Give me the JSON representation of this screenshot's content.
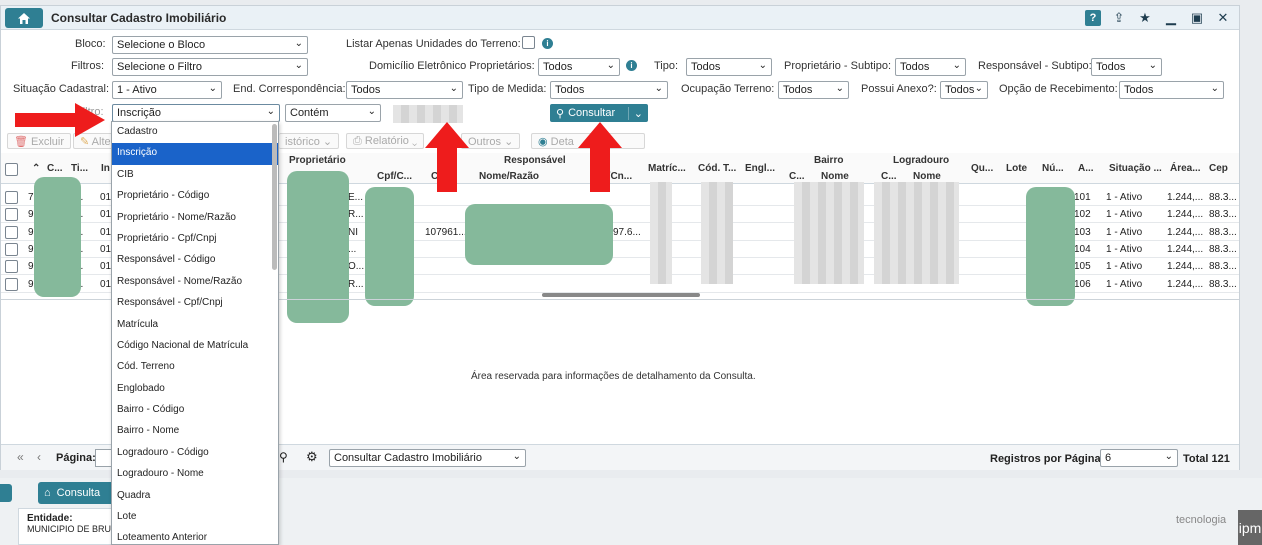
{
  "window": {
    "title": "Consultar Cadastro Imobiliário"
  },
  "filters": {
    "bloco_label": "Bloco:",
    "bloco_value": "Selecione o Bloco",
    "filtros_label": "Filtros:",
    "filtros_value": "Selecione o Filtro",
    "situacao_label": "Situação Cadastral:",
    "situacao_value": "1 - Ativo",
    "listar_label": "Listar Apenas Unidades do Terreno:",
    "domicilio_label": "Domicílio Eletrônico Proprietários:",
    "domicilio_value": "Todos",
    "tipo_label": "Tipo:",
    "tipo_value": "Todos",
    "prop_subtipo_label": "Proprietário - Subtipo:",
    "prop_subtipo_value": "Todos",
    "resp_subtipo_label": "Responsável - Subtipo:",
    "resp_subtipo_value": "Todos",
    "end_label": "End. Correspondência:",
    "end_value": "Todos",
    "medida_label": "Tipo de Medida:",
    "medida_value": "Todos",
    "ocupacao_label": "Ocupação Terreno:",
    "ocupacao_value": "Todos",
    "anexo_label": "Possui Anexo?:",
    "anexo_value": "Todos",
    "recebimento_label": "Opção de Recebimento:",
    "recebimento_value": "Todos",
    "filtro_label": "Filtro:",
    "filtro_value": "Inscrição",
    "operador_value": "Contém",
    "consultar_label": "Consultar"
  },
  "toolbar": {
    "excluir": "Excluir",
    "alterar": "Alte",
    "historico": "istórico",
    "relatorio": "Relatório",
    "outros": "Outros",
    "detalhes": "Deta"
  },
  "grid": {
    "h_c": "C...",
    "h_ti": "Ti...",
    "h_in": "In",
    "h_proprietario": "Proprietário",
    "h_cpf": "Cpf/C...",
    "h_responsavel": "Responsável",
    "h_c2": "C",
    "h_nome_razao": "Nome/Razão",
    "h_cpfcn": "Cpf/Cn...",
    "h_matric": "Matríc...",
    "h_cod_t": "Cód. T...",
    "h_engl": "Engl...",
    "h_bairro": "Bairro",
    "h_bc": "C...",
    "h_bnome": "Nome",
    "h_logradouro": "Logradouro",
    "h_lc": "C...",
    "h_lnome": "Nome",
    "h_qu": "Qu...",
    "h_lote": "Lote",
    "h_nu": "Nú...",
    "h_a": "A...",
    "h_situacao": "Situação ...",
    "h_area": "Área...",
    "h_cep": "Cep",
    "rows": [
      {
        "c": "7",
        "ti": "...",
        "in": "01.",
        "prop": "E...",
        "resp_c": "",
        "resp_cpf": "",
        "a": "101",
        "sit": "1 - Ativo",
        "area": "1.244,...",
        "cep": "88.3..."
      },
      {
        "c": "9",
        "ti": "...",
        "in": "01.",
        "prop": "R...",
        "resp_c": "",
        "resp_cpf": "",
        "a": "102",
        "sit": "1 - Ativo",
        "area": "1.244,...",
        "cep": "88.3..."
      },
      {
        "c": "9",
        "ti": "...",
        "in": "01.",
        "prop": "NI",
        "resp_c": "107961...",
        "resp_cpf": "97.6...",
        "a": "103",
        "sit": "1 - Ativo",
        "area": "1.244,...",
        "cep": "88.3..."
      },
      {
        "c": "9",
        "ti": "...",
        "in": "01.",
        "prop": "...",
        "resp_c": "",
        "resp_cpf": "",
        "a": "104",
        "sit": "1 - Ativo",
        "area": "1.244,...",
        "cep": "88.3..."
      },
      {
        "c": "9",
        "ti": "...",
        "in": "01.",
        "prop": "O...",
        "resp_c": "",
        "resp_cpf": "",
        "a": "105",
        "sit": "1 - Ativo",
        "area": "1.244,...",
        "cep": "88.3..."
      },
      {
        "c": "9",
        "ti": "...",
        "in": "01.",
        "prop": "R...",
        "resp_c": "",
        "resp_cpf": "",
        "a": "106",
        "sit": "1 - Ativo",
        "area": "1.244,...",
        "cep": "88.3..."
      }
    ]
  },
  "detail": {
    "text": "Área reservada para informações de detalhamento da Consulta."
  },
  "pager": {
    "pagina_label": "Página:",
    "consulta_value": "Consultar Cadastro Imobiliário",
    "registros_label": "Registros por Página:",
    "registros_value": "6",
    "total": "Total 121"
  },
  "dropdown_options": [
    "Cadastro",
    "Inscrição",
    "CIB",
    "Proprietário - Código",
    "Proprietário - Nome/Razão",
    "Proprietário - Cpf/Cnpj",
    "Responsável - Código",
    "Responsável - Nome/Razão",
    "Responsável - Cpf/Cnpj",
    "Matrícula",
    "Código Nacional de Matrícula",
    "Cód. Terreno",
    "Englobado",
    "Bairro - Código",
    "Bairro - Nome",
    "Logradouro - Código",
    "Logradouro - Nome",
    "Quadra",
    "Lote",
    "Loteamento Anterior"
  ],
  "dropdown_selected": "Inscrição",
  "footer": {
    "tab_label": "Consulta",
    "entidade_label": "Entidade:",
    "entidade_value": "MUNICIPIO DE BRU",
    "brand": "tecnologia",
    "brand_box": "ipm"
  },
  "colors": {
    "accent": "#2f7f93",
    "selected": "#1a63c9",
    "arrow": "#ee1c1c",
    "redaction": "#85b99b"
  }
}
